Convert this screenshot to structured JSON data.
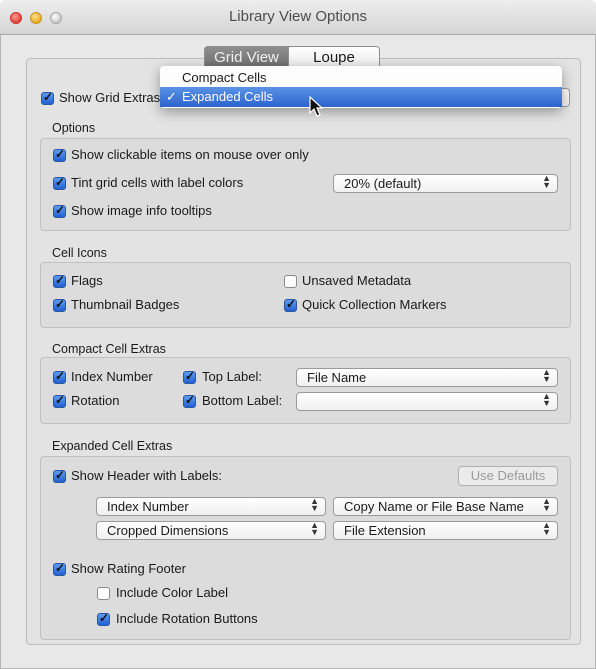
{
  "window": {
    "title": "Library View Options"
  },
  "tabs": [
    {
      "label": "Grid View",
      "selected": true
    },
    {
      "label": "Loupe View",
      "selected": false
    }
  ],
  "menu": {
    "items": [
      {
        "label": "Compact Cells",
        "selected": false
      },
      {
        "label": "Expanded Cells",
        "selected": true,
        "check": "✓"
      }
    ]
  },
  "grid_extras": {
    "label": "Show Grid Extras",
    "checked": true
  },
  "options": {
    "title": "Options",
    "show_clickable": {
      "label": "Show clickable items on mouse over only",
      "checked": true
    },
    "tint_cells": {
      "label": "Tint grid cells with label colors",
      "checked": true,
      "value": "20% (default)"
    },
    "tooltips": {
      "label": "Show image info tooltips",
      "checked": true
    }
  },
  "cell_icons": {
    "title": "Cell Icons",
    "flags": {
      "label": "Flags",
      "checked": true
    },
    "unsaved_metadata": {
      "label": "Unsaved Metadata",
      "checked": false
    },
    "thumbnail_badges": {
      "label": "Thumbnail Badges",
      "checked": true
    },
    "quick_collection": {
      "label": "Quick Collection Markers",
      "checked": true
    }
  },
  "compact_extras": {
    "title": "Compact Cell Extras",
    "index_number": {
      "label": "Index Number",
      "checked": true
    },
    "rotation": {
      "label": "Rotation",
      "checked": true
    },
    "top_label": {
      "label": "Top Label:",
      "checked": true,
      "value": "File Name"
    },
    "bottom_label": {
      "label": "Bottom Label:",
      "checked": true,
      "value": ""
    }
  },
  "expanded_extras": {
    "title": "Expanded Cell Extras",
    "header": {
      "label": "Show Header with Labels:",
      "checked": true
    },
    "use_defaults": "Use Defaults",
    "field1": "Index Number",
    "field2": "Copy Name or File Base Name",
    "field3": "Cropped Dimensions",
    "field4": "File Extension",
    "rating_footer": {
      "label": "Show Rating Footer",
      "checked": true
    },
    "color_label": {
      "label": "Include Color Label",
      "checked": false
    },
    "rotation_buttons": {
      "label": "Include Rotation Buttons",
      "checked": true
    }
  },
  "colors": {
    "accent": "#2b63cd",
    "window_bg": "#e8e8e8"
  }
}
